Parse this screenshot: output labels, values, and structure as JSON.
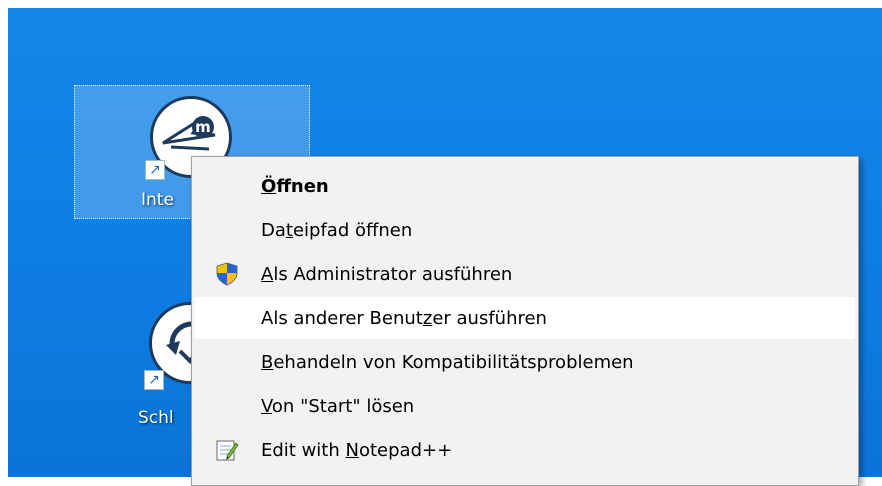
{
  "desktop": {
    "background_color": "#0f7fe3",
    "icons": [
      {
        "label": "Inte",
        "icon": "app-logo-m-icon",
        "selected": true
      },
      {
        "label": "Schl",
        "icon": "sync-arrows-icon",
        "selected": false
      }
    ]
  },
  "context_menu": {
    "items": [
      {
        "label_parts": [
          "",
          "Ö",
          "ffnen"
        ],
        "bold": true,
        "icon": null
      },
      {
        "label_parts": [
          "Da",
          "t",
          "eipfad öffnen"
        ],
        "bold": false,
        "icon": null
      },
      {
        "label_parts": [
          "",
          "A",
          "ls Administrator ausführen"
        ],
        "bold": false,
        "icon": "uac-shield-icon"
      },
      {
        "label_parts": [
          "Als anderer Benut",
          "z",
          "er ausführen"
        ],
        "bold": false,
        "icon": null,
        "highlighted": true
      },
      {
        "label_parts": [
          "",
          "B",
          "ehandeln von Kompatibilitätsproblemen"
        ],
        "bold": false,
        "icon": null
      },
      {
        "label_parts": [
          "",
          "V",
          "on \"Start\" lösen"
        ],
        "bold": false,
        "icon": null
      },
      {
        "label_parts": [
          "Edit with ",
          "N",
          "otepad++"
        ],
        "bold": false,
        "icon": "notepadpp-icon"
      }
    ],
    "colors": {
      "background": "#f2f2f2",
      "hover": "#ffffff",
      "border": "#a0a0a0"
    }
  }
}
